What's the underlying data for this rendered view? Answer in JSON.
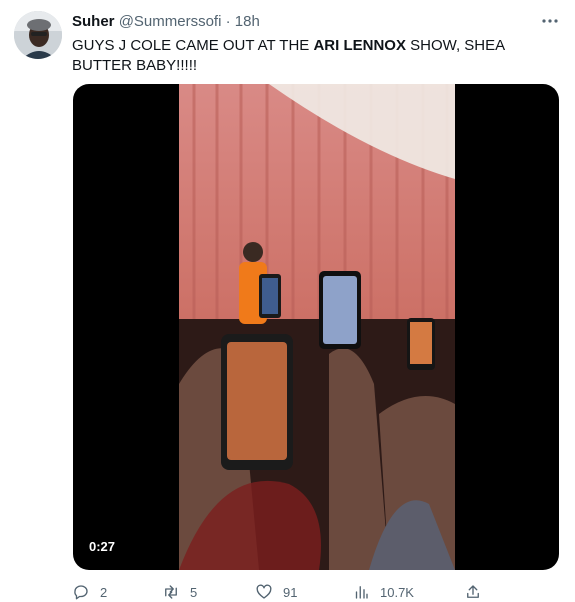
{
  "tweet": {
    "author_name": "Suher",
    "handle": "@Summerssofi",
    "separator": "·",
    "time": "18h",
    "text_part1": "GUYS J COLE CAME OUT AT THE ",
    "text_bold": "ARI LENNOX",
    "text_part2": " SHOW, SHEA BUTTER BABY!!!!!"
  },
  "media": {
    "duration": "0:27"
  },
  "actions": {
    "replies": "2",
    "retweets": "5",
    "likes": "91",
    "views": "10.7K"
  },
  "icons": {
    "more": "more-dots-icon",
    "reply": "reply-icon",
    "retweet": "retweet-icon",
    "like": "heart-icon",
    "views": "views-icon",
    "share": "share-icon"
  },
  "colors": {
    "secondary_text": "#536471",
    "primary_text": "#0f1419"
  }
}
